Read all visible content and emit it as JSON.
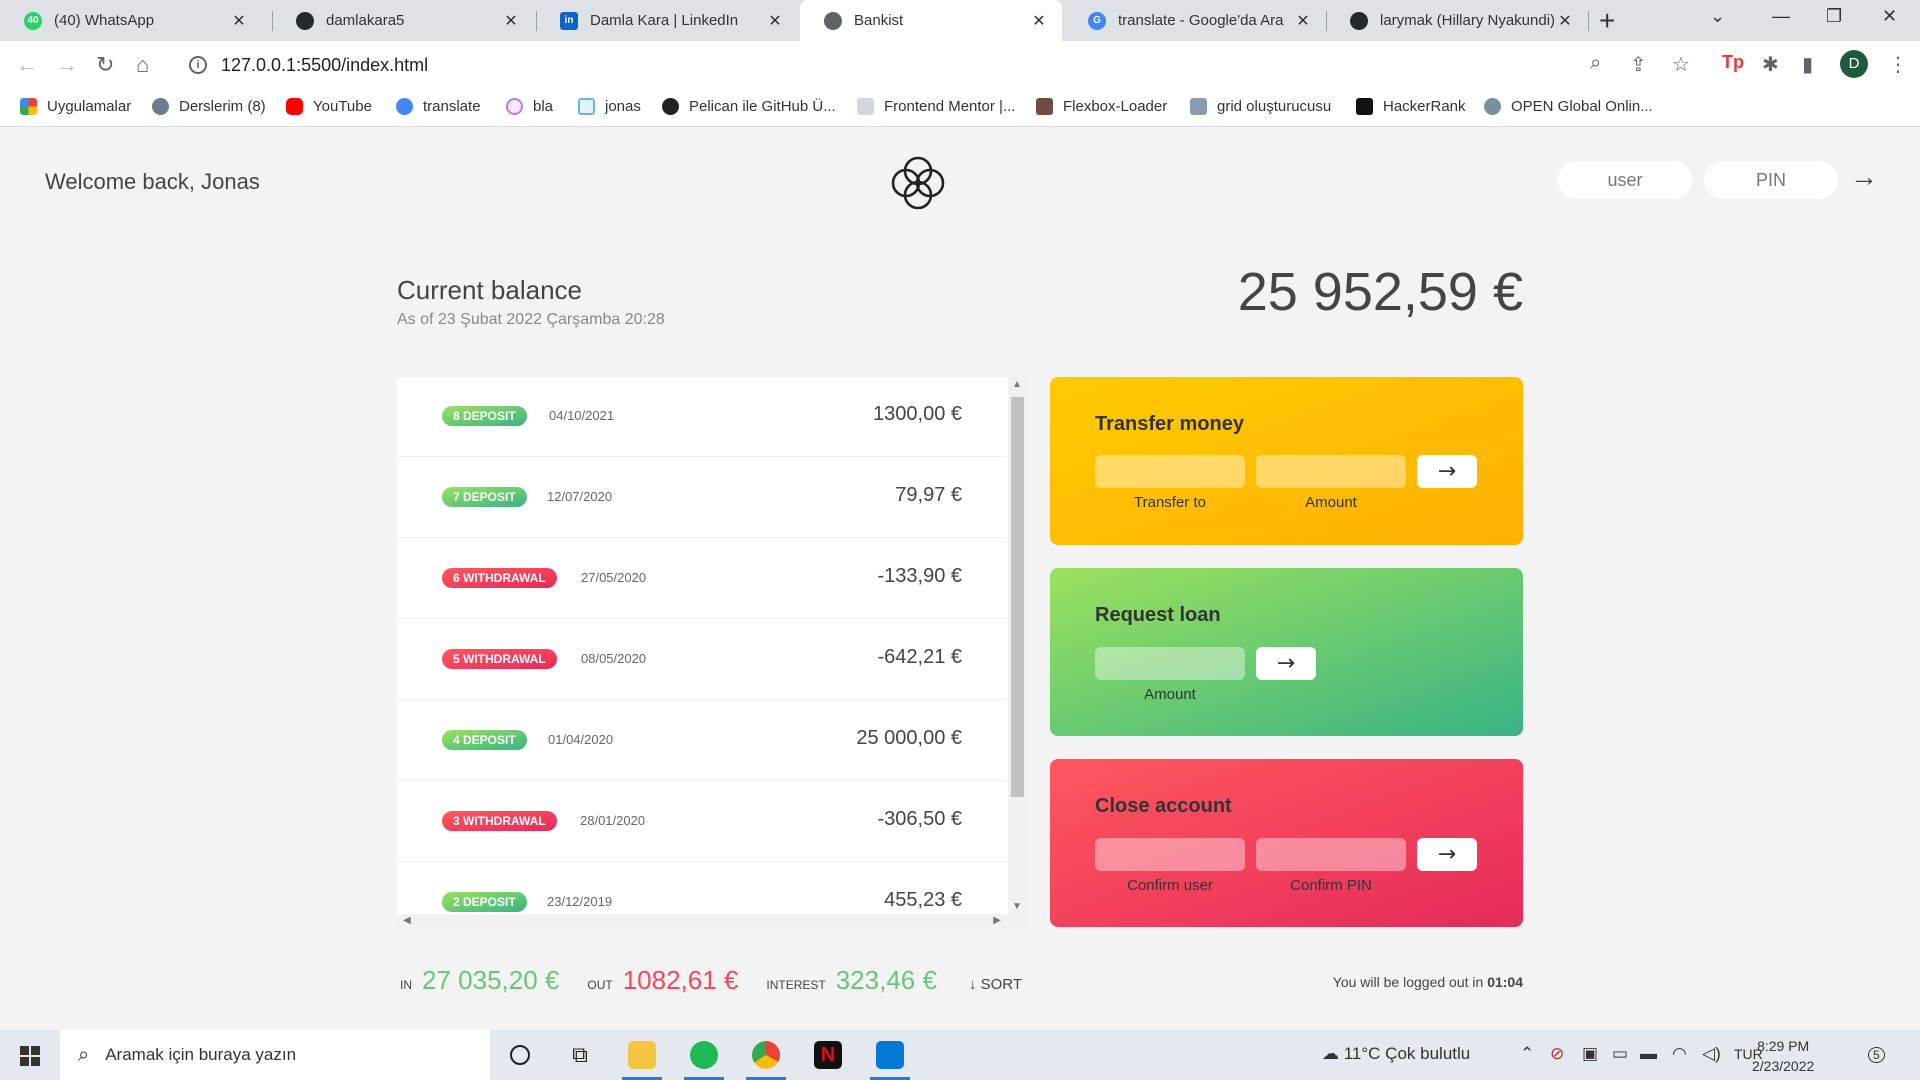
{
  "browser": {
    "tabs": [
      {
        "label": "(40) WhatsApp",
        "favicon": "whatsapp-icon",
        "favicon_text": "40"
      },
      {
        "label": "damlakara5",
        "favicon": "github-icon",
        "favicon_text": ""
      },
      {
        "label": "Damla Kara | LinkedIn",
        "favicon": "linkedin-icon",
        "favicon_text": "in"
      },
      {
        "label": "Bankist",
        "favicon": "globe-icon",
        "favicon_text": ""
      },
      {
        "label": "translate - Google'da Ara",
        "favicon": "google-icon",
        "favicon_text": "G"
      },
      {
        "label": "larymak (Hillary Nyakundi)",
        "favicon": "github-icon",
        "favicon_text": ""
      }
    ],
    "active_tab": 3,
    "url": "127.0.0.1:5500/index.html",
    "profile_initial": "D",
    "bookmarks": [
      {
        "label": "Uygulamalar",
        "icon": "apps-grid-icon"
      },
      {
        "label": "Derslerim (8)",
        "icon": "course-icon"
      },
      {
        "label": "YouTube",
        "icon": "youtube-icon"
      },
      {
        "label": "translate",
        "icon": "google-icon"
      },
      {
        "label": "bla",
        "icon": "bla-icon"
      },
      {
        "label": "jonas",
        "icon": "heart-icon"
      },
      {
        "label": "Pelican ile GitHub Ü...",
        "icon": "pelican-icon"
      },
      {
        "label": "Frontend Mentor |...",
        "icon": "frontend-mentor-icon"
      },
      {
        "label": "Flexbox-Loader",
        "icon": "flexbox-icon"
      },
      {
        "label": "grid oluşturucusu",
        "icon": "grid-icon"
      },
      {
        "label": "HackerRank",
        "icon": "hackerrank-icon"
      },
      {
        "label": "OPEN Global Onlin...",
        "icon": "open-global-icon"
      }
    ]
  },
  "app": {
    "welcome": "Welcome back, Jonas",
    "login": {
      "user_placeholder": "user",
      "pin_placeholder": "PIN",
      "arrow": "→"
    },
    "balance": {
      "title": "Current balance",
      "date_label": "As of 23 Şubat 2022 Çarşamba 20:28",
      "value": "25 952,59 €"
    },
    "movements": [
      {
        "type_label": "8 deposit",
        "kind": "deposit",
        "date": "04/10/2021",
        "value": "1300,00 €"
      },
      {
        "type_label": "7 deposit",
        "kind": "deposit",
        "date": "12/07/2020",
        "value": "79,97 €"
      },
      {
        "type_label": "6 withdrawal",
        "kind": "withdrawal",
        "date": "27/05/2020",
        "value": "-133,90 €"
      },
      {
        "type_label": "5 withdrawal",
        "kind": "withdrawal",
        "date": "08/05/2020",
        "value": "-642,21 €"
      },
      {
        "type_label": "4 deposit",
        "kind": "deposit",
        "date": "01/04/2020",
        "value": "25 000,00 €"
      },
      {
        "type_label": "3 withdrawal",
        "kind": "withdrawal",
        "date": "28/01/2020",
        "value": "-306,50 €"
      },
      {
        "type_label": "2 deposit",
        "kind": "deposit",
        "date": "23/12/2019",
        "value": "455,23 €"
      }
    ],
    "operations": {
      "transfer": {
        "title": "Transfer money",
        "label_to": "Transfer to",
        "label_amount": "Amount",
        "button": "→"
      },
      "loan": {
        "title": "Request loan",
        "label_amount": "Amount",
        "button": "→"
      },
      "close": {
        "title": "Close account",
        "label_user": "Confirm user",
        "label_pin": "Confirm PIN",
        "button": "→"
      }
    },
    "summary": {
      "in_label": "In",
      "in_value": "27 035,20 €",
      "out_label": "Out",
      "out_value": "1082,61 €",
      "interest_label": "Interest",
      "interest_value": "323,46 €",
      "sort_label": "↓ SORT"
    },
    "logout": {
      "text": "You will be logged out in",
      "timer": "01:04"
    }
  },
  "taskbar": {
    "search_placeholder": "Aramak için buraya yazın",
    "apps": [
      "cortana-icon",
      "task-view-icon",
      "file-explorer-icon",
      "spotify-icon",
      "chrome-icon",
      "netflix-icon",
      "vscode-icon"
    ],
    "weather": "11°C  Çok bulutlu",
    "language": "TUR",
    "time": "8:29 PM",
    "date": "2/23/2022",
    "notification_count": "5"
  },
  "colors": {
    "deposit": "#66c873",
    "withdrawal": "#f5465d",
    "transfer_gradient": [
      "#ffb003",
      "#ffcb03"
    ],
    "loan_gradient": [
      "#39b385",
      "#9be15d"
    ],
    "close_gradient": [
      "#e52a5a",
      "#ff585f"
    ]
  }
}
